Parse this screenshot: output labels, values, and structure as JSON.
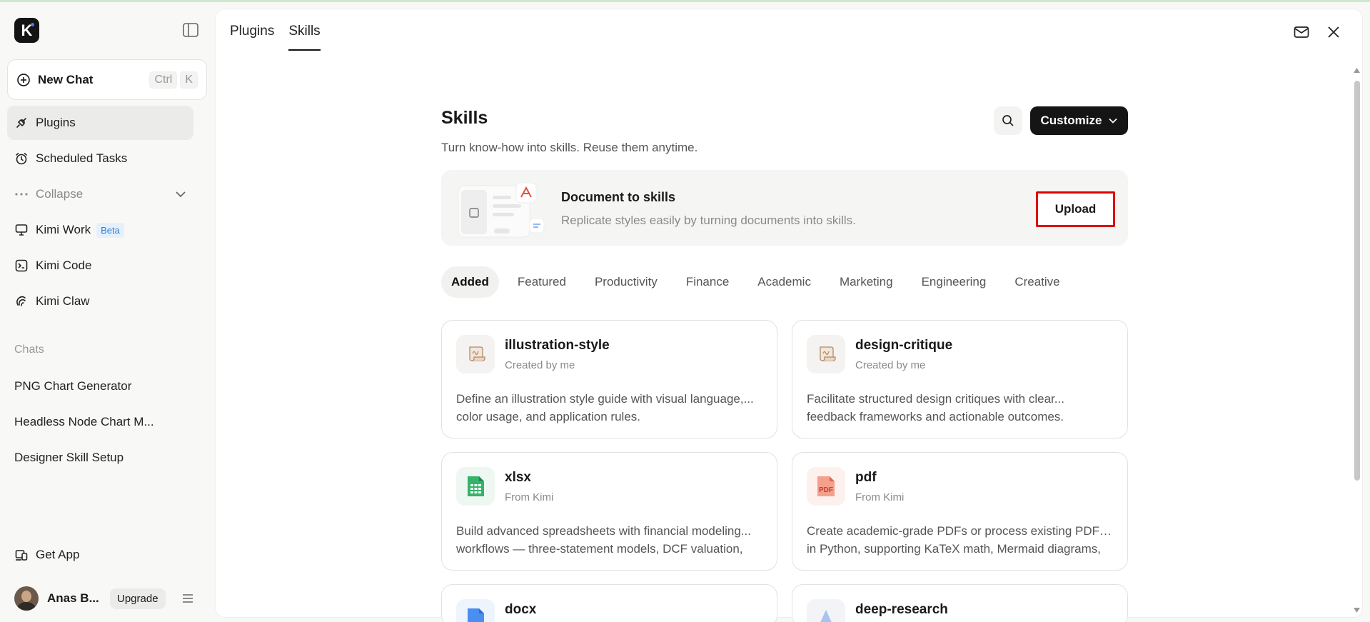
{
  "sidebar": {
    "logo_letter": "K",
    "new_chat": {
      "label": "New Chat",
      "shortcut_ctrl": "Ctrl",
      "shortcut_key": "K"
    },
    "nav": [
      {
        "label": "Plugins",
        "icon": "plug-icon"
      },
      {
        "label": "Scheduled Tasks",
        "icon": "alarm-clock-icon"
      },
      {
        "label": "Collapse",
        "icon": "more-dots-icon"
      },
      {
        "label": "Kimi Work",
        "icon": "monitor-icon",
        "badge": "Beta"
      },
      {
        "label": "Kimi Code",
        "icon": "terminal-icon"
      },
      {
        "label": "Kimi Claw",
        "icon": "claw-icon"
      }
    ],
    "chats_label": "Chats",
    "chats": [
      "PNG Chart Generator",
      "Headless Node Chart M...",
      "Designer Skill Setup"
    ],
    "get_app": "Get App",
    "user": {
      "name": "Anas B...",
      "upgrade": "Upgrade"
    }
  },
  "header": {
    "tabs": [
      "Plugins",
      "Skills"
    ],
    "active_tab": "Skills"
  },
  "skills": {
    "title": "Skills",
    "subtitle": "Turn know-how into skills. Reuse them anytime.",
    "customize_label": "Customize",
    "banner": {
      "title": "Document to skills",
      "description": "Replicate styles easily by turning documents into skills.",
      "upload_label": "Upload"
    },
    "categories": [
      "Added",
      "Featured",
      "Productivity",
      "Finance",
      "Academic",
      "Marketing",
      "Engineering",
      "Creative"
    ],
    "active_category": "Added",
    "cards": [
      {
        "title": "illustration-style",
        "source": "Created by me",
        "desc1": "Define an illustration style guide with visual language,...",
        "desc2": "color usage, and application rules.",
        "icon": "scroll-icon"
      },
      {
        "title": "design-critique",
        "source": "Created by me",
        "desc1": "Facilitate structured design critiques with clear...",
        "desc2": "feedback frameworks and actionable outcomes.",
        "icon": "scroll-icon"
      },
      {
        "title": "xlsx",
        "source": "From Kimi",
        "desc1": "Build advanced spreadsheets with financial modeling...",
        "desc2": "workflows — three-statement models, DCF valuation,",
        "icon": "spreadsheet-icon"
      },
      {
        "title": "pdf",
        "source": "From Kimi",
        "desc1": "Create academic-grade PDFs or process existing PDFs...",
        "desc2": "in Python, supporting KaTeX math, Mermaid diagrams,",
        "icon": "pdf-icon"
      },
      {
        "title": "docx",
        "source": "",
        "desc1": "",
        "desc2": "",
        "icon": "word-doc-icon"
      },
      {
        "title": "deep-research",
        "source": "",
        "desc1": "",
        "desc2": "",
        "icon": "research-icon"
      }
    ],
    "pdf_icon_text": "PDF"
  },
  "colors": {
    "accent_dark": "#151515",
    "beta_blue": "#2f7bd8",
    "highlight_red": "#e00000",
    "xlsx_green": "#22a05a",
    "pdf_red": "#e8664e",
    "docx_blue": "#3b82f6"
  }
}
